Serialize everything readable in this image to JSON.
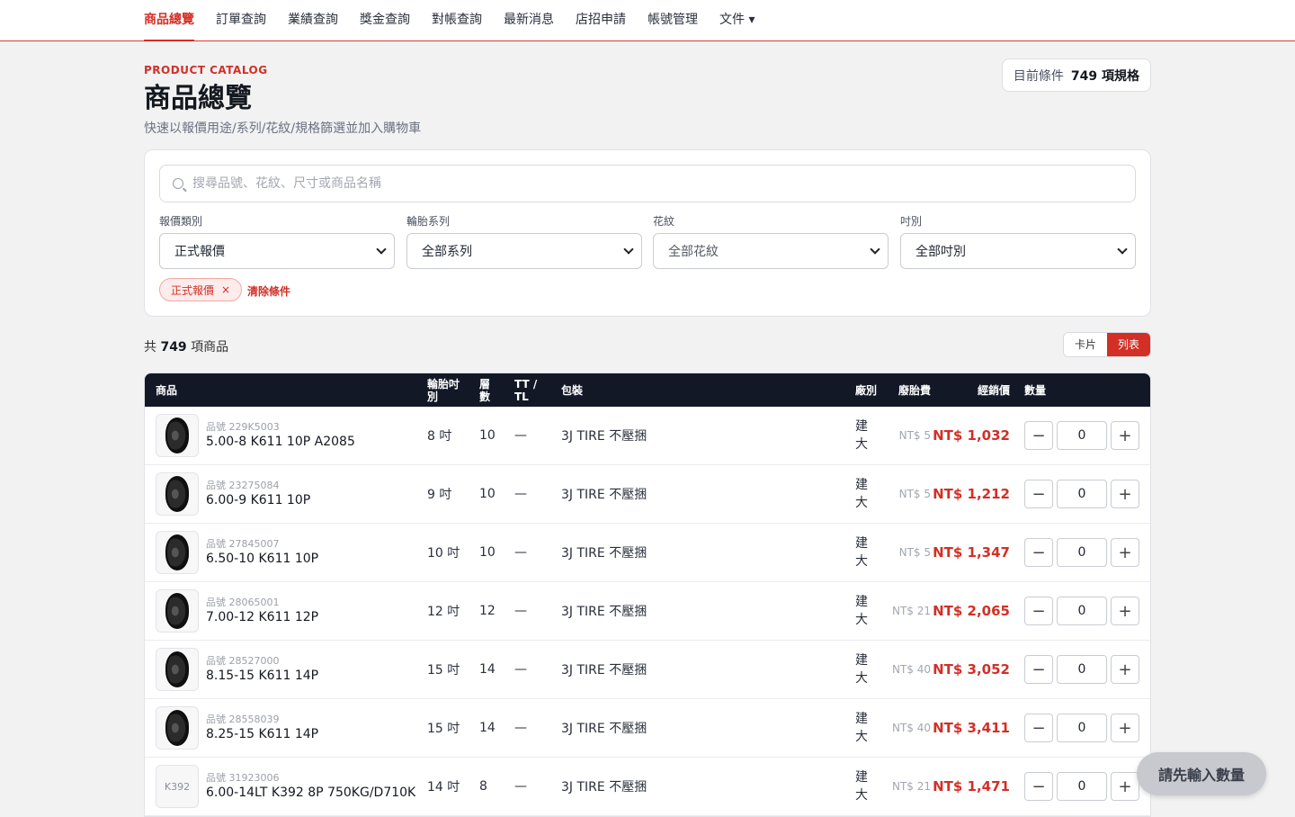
{
  "nav": {
    "items": [
      {
        "label": "商品總覽",
        "active": true
      },
      {
        "label": "訂單查詢",
        "active": false
      },
      {
        "label": "業績查詢",
        "active": false
      },
      {
        "label": "獎金查詢",
        "active": false
      },
      {
        "label": "對帳查詢",
        "active": false
      },
      {
        "label": "最新消息",
        "active": false
      },
      {
        "label": "店招申請",
        "active": false
      },
      {
        "label": "帳號管理",
        "active": false
      },
      {
        "label": "文件 ▾",
        "active": false
      }
    ]
  },
  "header": {
    "eyebrow": "PRODUCT CATALOG",
    "title": "商品總覽",
    "subtitle": "快速以報價用途/系列/花紋/規格篩選並加入購物車",
    "badge_label": "目前條件",
    "badge_value": "749 項規格"
  },
  "filters": {
    "search_placeholder": "搜尋品號、花紋、尺寸或商品名稱",
    "quote_type": {
      "label": "報價類別",
      "value": "正式報價"
    },
    "series": {
      "label": "輪胎系列",
      "value": "全部系列"
    },
    "pattern": {
      "label": "花紋",
      "value": "全部花紋"
    },
    "size": {
      "label": "吋別",
      "value": "全部吋別"
    },
    "active_chip": "正式報價",
    "chip_close": "×",
    "clear_label": "清除條件"
  },
  "results": {
    "prefix": "共",
    "count": "749",
    "suffix": "項商品"
  },
  "view_toggle": {
    "card": "卡片",
    "list": "列表"
  },
  "table": {
    "headers": {
      "product": "商品",
      "size": "輪胎吋別",
      "ply": "層數",
      "tt": "TT / TL",
      "pack": "包裝",
      "factory": "廠別",
      "fee": "廢胎費",
      "price": "經銷價",
      "qty": "數量"
    },
    "rows": [
      {
        "thumb": "tire",
        "thumb_text": "",
        "code": "品號 229K5003",
        "name": "5.00-8 K611 10P A2085",
        "size": "8 吋",
        "ply": "10",
        "tt": "—",
        "pack": "3J TIRE 不壓捆",
        "factory": "建大",
        "fee": "NT$ 5",
        "price": "NT$ 1,032",
        "qty": "0"
      },
      {
        "thumb": "tire",
        "thumb_text": "",
        "code": "品號 23275084",
        "name": "6.00-9 K611 10P",
        "size": "9 吋",
        "ply": "10",
        "tt": "—",
        "pack": "3J TIRE 不壓捆",
        "factory": "建大",
        "fee": "NT$ 5",
        "price": "NT$ 1,212",
        "qty": "0"
      },
      {
        "thumb": "tire",
        "thumb_text": "",
        "code": "品號 27845007",
        "name": "6.50-10 K611 10P",
        "size": "10 吋",
        "ply": "10",
        "tt": "—",
        "pack": "3J TIRE 不壓捆",
        "factory": "建大",
        "fee": "NT$ 5",
        "price": "NT$ 1,347",
        "qty": "0"
      },
      {
        "thumb": "tire",
        "thumb_text": "",
        "code": "品號 28065001",
        "name": "7.00-12 K611 12P",
        "size": "12 吋",
        "ply": "12",
        "tt": "—",
        "pack": "3J TIRE 不壓捆",
        "factory": "建大",
        "fee": "NT$ 21",
        "price": "NT$ 2,065",
        "qty": "0"
      },
      {
        "thumb": "tire",
        "thumb_text": "",
        "code": "品號 28527000",
        "name": "8.15-15 K611 14P",
        "size": "15 吋",
        "ply": "14",
        "tt": "—",
        "pack": "3J TIRE 不壓捆",
        "factory": "建大",
        "fee": "NT$ 40",
        "price": "NT$ 3,052",
        "qty": "0"
      },
      {
        "thumb": "tire",
        "thumb_text": "",
        "code": "品號 28558039",
        "name": "8.25-15 K611 14P",
        "size": "15 吋",
        "ply": "14",
        "tt": "—",
        "pack": "3J TIRE 不壓捆",
        "factory": "建大",
        "fee": "NT$ 40",
        "price": "NT$ 3,411",
        "qty": "0"
      },
      {
        "thumb": "text",
        "thumb_text": "K392",
        "code": "品號 31923006",
        "name": "6.00-14LT K392 8P 750KG/D710K",
        "size": "14 吋",
        "ply": "8",
        "tt": "—",
        "pack": "3J TIRE 不壓捆",
        "factory": "建大",
        "fee": "NT$ 21",
        "price": "NT$ 1,471",
        "qty": "0"
      }
    ]
  },
  "fab": {
    "label": "請先輸入數量"
  },
  "colors": {
    "accent": "#d32f26",
    "table_header": "#121826",
    "background": "#f2f2f3"
  }
}
